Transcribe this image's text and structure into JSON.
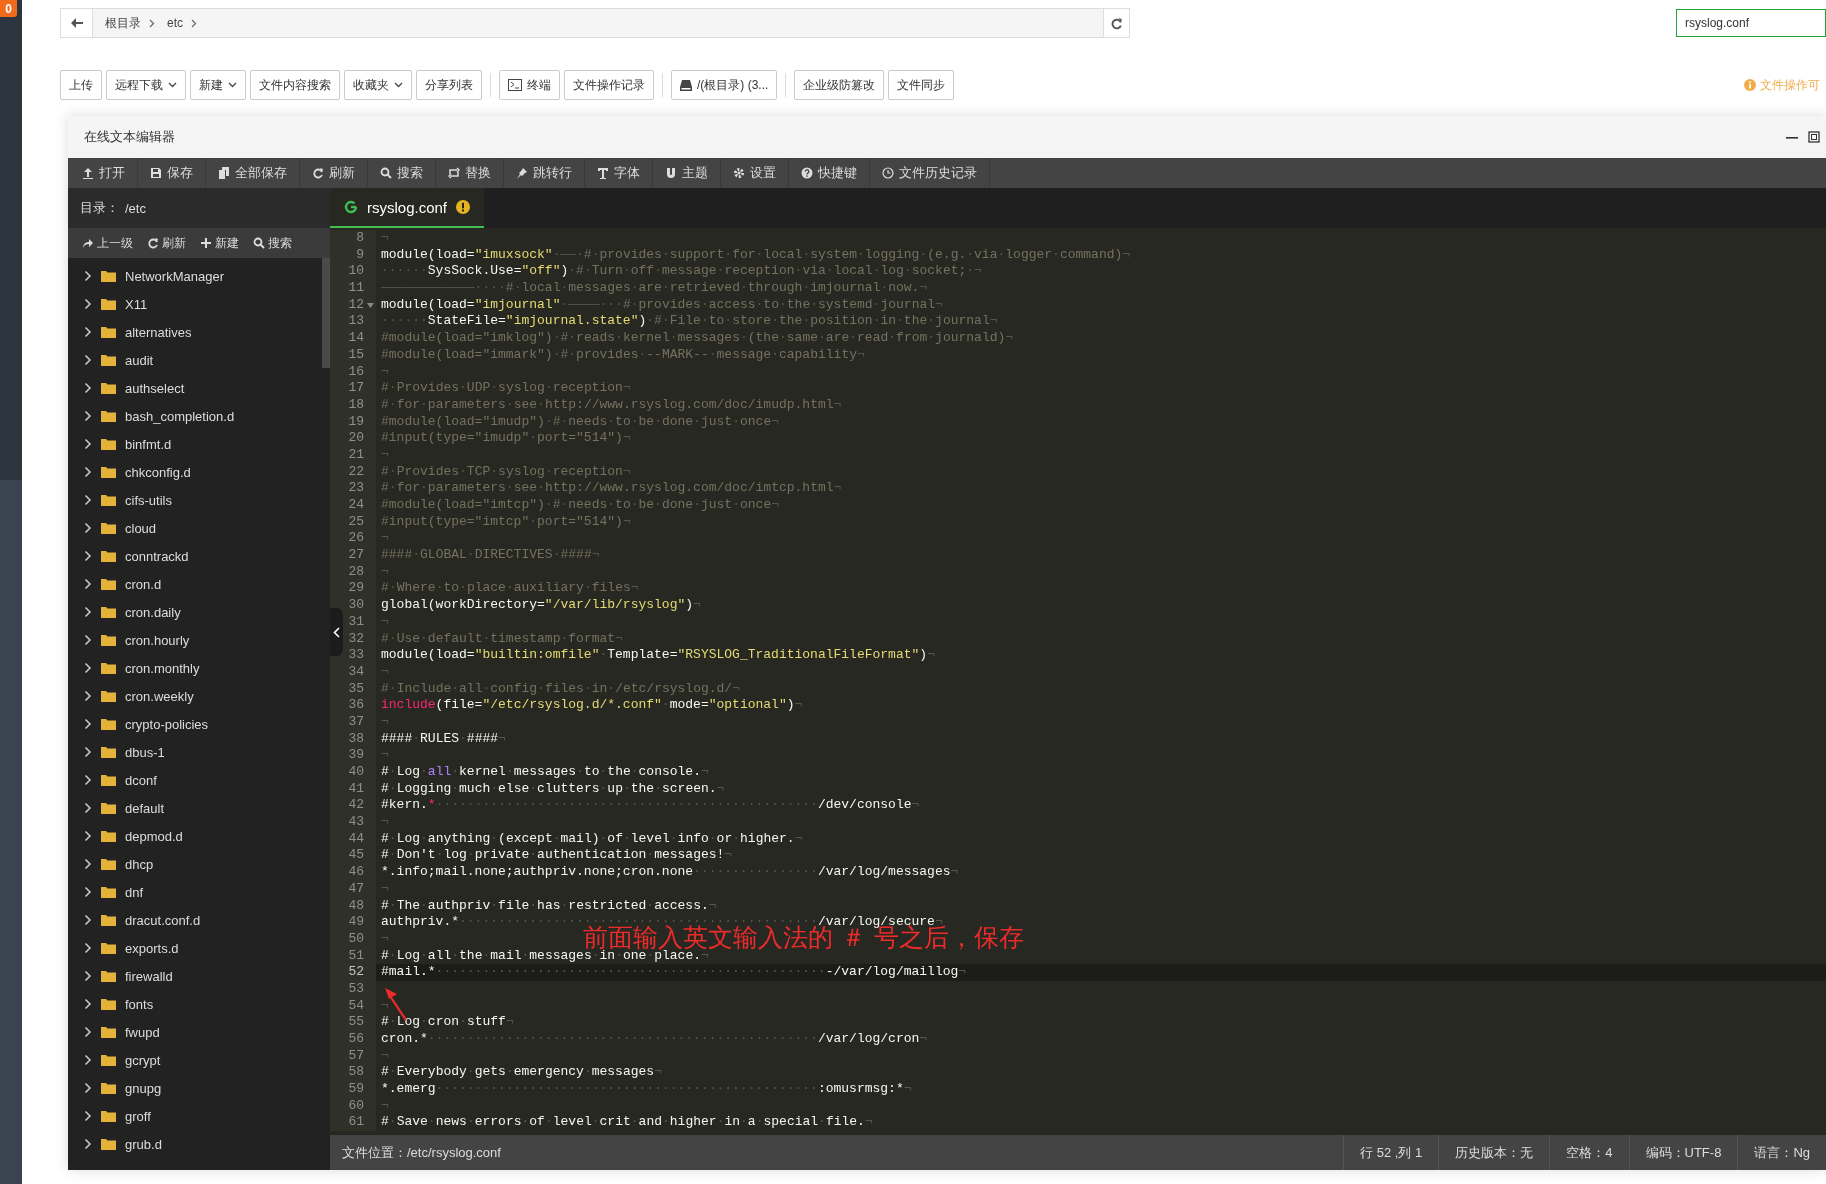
{
  "notification_count": "0",
  "breadcrumb": [
    "根目录",
    "etc"
  ],
  "path_search": {
    "value": "rsyslog.conf"
  },
  "toolbar": [
    {
      "label": "上传",
      "kind": "plain"
    },
    {
      "label": "远程下载",
      "kind": "dropdown"
    },
    {
      "label": "新建",
      "kind": "dropdown"
    },
    {
      "label": "文件内容搜索",
      "kind": "plain"
    },
    {
      "label": "收藏夹",
      "kind": "dropdown"
    },
    {
      "label": "分享列表",
      "kind": "plain"
    },
    {
      "label": "终端",
      "kind": "terminal"
    },
    {
      "label": "文件操作记录",
      "kind": "plain"
    },
    {
      "label": "/(根目录) (3...",
      "kind": "disk"
    },
    {
      "label": "企业级防篡改",
      "kind": "plain"
    },
    {
      "label": "文件同步",
      "kind": "plain"
    }
  ],
  "notice": "文件操作可",
  "editor": {
    "title": "在线文本编辑器",
    "toolbar": [
      "打开",
      "保存",
      "全部保存",
      "刷新",
      "搜索",
      "替换",
      "跳转行",
      "字体",
      "主题",
      "设置",
      "快捷键",
      "文件历史记录"
    ],
    "sidebar": {
      "dir_label": "目录：",
      "dir": "/etc",
      "actions": [
        "上一级",
        "刷新",
        "新建",
        "搜索"
      ],
      "items": [
        {
          "name": "NetworkManager",
          "expanded": false
        },
        {
          "name": "X11",
          "expanded": false
        },
        {
          "name": "alternatives",
          "expanded": false
        },
        {
          "name": "audit",
          "expanded": false
        },
        {
          "name": "authselect",
          "expanded": false
        },
        {
          "name": "bash_completion.d",
          "expanded": false
        },
        {
          "name": "binfmt.d",
          "expanded": false
        },
        {
          "name": "chkconfig.d",
          "expanded": false
        },
        {
          "name": "cifs-utils",
          "expanded": false
        },
        {
          "name": "cloud",
          "expanded": false
        },
        {
          "name": "conntrackd",
          "expanded": false
        },
        {
          "name": "cron.d",
          "expanded": false
        },
        {
          "name": "cron.daily",
          "expanded": false
        },
        {
          "name": "cron.hourly",
          "expanded": false
        },
        {
          "name": "cron.monthly",
          "expanded": false
        },
        {
          "name": "cron.weekly",
          "expanded": false
        },
        {
          "name": "crypto-policies",
          "expanded": false
        },
        {
          "name": "dbus-1",
          "expanded": false
        },
        {
          "name": "dconf",
          "expanded": false
        },
        {
          "name": "default",
          "expanded": false
        },
        {
          "name": "depmod.d",
          "expanded": false
        },
        {
          "name": "dhcp",
          "expanded": false
        },
        {
          "name": "dnf",
          "expanded": false
        },
        {
          "name": "dracut.conf.d",
          "expanded": false
        },
        {
          "name": "exports.d",
          "expanded": false
        },
        {
          "name": "firewalld",
          "expanded": false
        },
        {
          "name": "fonts",
          "expanded": false
        },
        {
          "name": "fwupd",
          "expanded": false
        },
        {
          "name": "gcrypt",
          "expanded": false
        },
        {
          "name": "gnupg",
          "expanded": false
        },
        {
          "name": "groff",
          "expanded": false
        },
        {
          "name": "grub.d",
          "expanded": false
        }
      ]
    },
    "tabs": [
      {
        "label": "rsyslog.conf",
        "selected": true,
        "modified": true
      }
    ],
    "lines": [
      {
        "n": "8",
        "active": false,
        "segs": [
          {
            "text": "¬",
            "kind": "p"
          }
        ]
      },
      {
        "n": "9",
        "active": false,
        "segs": [
          {
            "text": "module(load=",
            "kind": "p"
          },
          {
            "text": "\"imuxsock\"",
            "kind": "s"
          },
          {
            "text": "·——·",
            "kind": "p"
          },
          {
            "text": "#·provides·support·for·local·system·logging·(e.g.·via·logger·command)¬",
            "kind": "c"
          }
        ]
      },
      {
        "n": "10",
        "active": false,
        "segs": [
          {
            "text": "······SysSock.Use=",
            "kind": "p"
          },
          {
            "text": "\"off\"",
            "kind": "s"
          },
          {
            "text": ")·",
            "kind": "p"
          },
          {
            "text": "#·Turn·off·message·reception·via·local·log·socket;·¬",
            "kind": "c"
          }
        ]
      },
      {
        "n": "11",
        "active": false,
        "segs": [
          {
            "text": "————————————····",
            "kind": "p"
          },
          {
            "text": "#·local·messages·are·retrieved·through·imjournal·now.¬",
            "kind": "c"
          }
        ]
      },
      {
        "n": "12",
        "active": false,
        "fold": true,
        "segs": [
          {
            "text": "module(load=",
            "kind": "p"
          },
          {
            "text": "\"imjournal\"",
            "kind": "s"
          },
          {
            "text": "·————···",
            "kind": "p"
          },
          {
            "text": "#·provides·access·to·the·systemd·journal¬",
            "kind": "c"
          }
        ]
      },
      {
        "n": "13",
        "active": false,
        "segs": [
          {
            "text": "······StateFile=",
            "kind": "p"
          },
          {
            "text": "\"imjournal.state\"",
            "kind": "s"
          },
          {
            "text": ")·",
            "kind": "p"
          },
          {
            "text": "#·File·to·store·the·position·in·the·journal¬",
            "kind": "c"
          }
        ]
      },
      {
        "n": "14",
        "active": false,
        "segs": [
          {
            "text": "#module(load=\"imklog\")·#·reads·kernel·messages·(the·same·are·read·from·journald)¬",
            "kind": "c"
          }
        ]
      },
      {
        "n": "15",
        "active": false,
        "segs": [
          {
            "text": "#module(load=\"immark\")·#·provides·--MARK--·message·capability¬",
            "kind": "c"
          }
        ]
      },
      {
        "n": "16",
        "active": false,
        "segs": [
          {
            "text": "¬",
            "kind": "p"
          }
        ]
      },
      {
        "n": "17",
        "active": false,
        "segs": [
          {
            "text": "#·Provides·UDP·syslog·reception¬",
            "kind": "c"
          }
        ]
      },
      {
        "n": "18",
        "active": false,
        "segs": [
          {
            "text": "#·for·parameters·see·http://www.rsyslog.com/doc/imudp.html¬",
            "kind": "c"
          }
        ]
      },
      {
        "n": "19",
        "active": false,
        "segs": [
          {
            "text": "#module(load=\"imudp\")·#·needs·to·be·done·just·once¬",
            "kind": "c"
          }
        ]
      },
      {
        "n": "20",
        "active": false,
        "segs": [
          {
            "text": "#input(type=\"imudp\"·port=\"514\")¬",
            "kind": "c"
          }
        ]
      },
      {
        "n": "21",
        "active": false,
        "segs": [
          {
            "text": "¬",
            "kind": "p"
          }
        ]
      },
      {
        "n": "22",
        "active": false,
        "segs": [
          {
            "text": "#·Provides·TCP·syslog·reception¬",
            "kind": "c"
          }
        ]
      },
      {
        "n": "23",
        "active": false,
        "segs": [
          {
            "text": "#·for·parameters·see·http://www.rsyslog.com/doc/imtcp.html¬",
            "kind": "c"
          }
        ]
      },
      {
        "n": "24",
        "active": false,
        "segs": [
          {
            "text": "#module(load=\"imtcp\")·#·needs·to·be·done·just·once¬",
            "kind": "c"
          }
        ]
      },
      {
        "n": "25",
        "active": false,
        "segs": [
          {
            "text": "#input(type=\"imtcp\"·port=\"514\")¬",
            "kind": "c"
          }
        ]
      },
      {
        "n": "26",
        "active": false,
        "segs": [
          {
            "text": "¬",
            "kind": "p"
          }
        ]
      },
      {
        "n": "27",
        "active": false,
        "segs": [
          {
            "text": "####·GLOBAL·DIRECTIVES·####¬",
            "kind": "c"
          }
        ]
      },
      {
        "n": "28",
        "active": false,
        "segs": [
          {
            "text": "¬",
            "kind": "p"
          }
        ]
      },
      {
        "n": "29",
        "active": false,
        "segs": [
          {
            "text": "#·Where·to·place·auxiliary·files¬",
            "kind": "c"
          }
        ]
      },
      {
        "n": "30",
        "active": false,
        "segs": [
          {
            "text": "global(workDirectory=",
            "kind": "p"
          },
          {
            "text": "\"/var/lib/rsyslog\"",
            "kind": "s"
          },
          {
            "text": ")¬",
            "kind": "p"
          }
        ]
      },
      {
        "n": "31",
        "active": false,
        "segs": [
          {
            "text": "¬",
            "kind": "p"
          }
        ]
      },
      {
        "n": "32",
        "active": false,
        "segs": [
          {
            "text": "#·Use·default·timestamp·format¬",
            "kind": "c"
          }
        ]
      },
      {
        "n": "33",
        "active": false,
        "segs": [
          {
            "text": "module(load=",
            "kind": "p"
          },
          {
            "text": "\"builtin:omfile\"",
            "kind": "s"
          },
          {
            "text": "·Template=",
            "kind": "p"
          },
          {
            "text": "\"RSYSLOG_TraditionalFileFormat\"",
            "kind": "s"
          },
          {
            "text": ")¬",
            "kind": "p"
          }
        ]
      },
      {
        "n": "34",
        "active": false,
        "segs": [
          {
            "text": "¬",
            "kind": "p"
          }
        ]
      },
      {
        "n": "35",
        "active": false,
        "segs": [
          {
            "text": "#·Include·all·config·files·in·/etc/rsyslog.d/¬",
            "kind": "c"
          }
        ]
      },
      {
        "n": "36",
        "active": false,
        "segs": [
          {
            "text": "include",
            "kind": "k"
          },
          {
            "text": "(file=",
            "kind": "p"
          },
          {
            "text": "\"/etc/rsyslog.d/*.conf\"",
            "kind": "s"
          },
          {
            "text": "·mode=",
            "kind": "p"
          },
          {
            "text": "\"optional\"",
            "kind": "s"
          },
          {
            "text": ")¬",
            "kind": "p"
          }
        ]
      },
      {
        "n": "37",
        "active": false,
        "segs": [
          {
            "text": "¬",
            "kind": "p"
          }
        ]
      },
      {
        "n": "38",
        "active": false,
        "segs": [
          {
            "text": "####·RULES·####¬",
            "kind": "p"
          }
        ]
      },
      {
        "n": "39",
        "active": false,
        "segs": [
          {
            "text": "¬",
            "kind": "p"
          }
        ]
      },
      {
        "n": "40",
        "active": false,
        "segs": [
          {
            "text": "#·Log·",
            "kind": "p"
          },
          {
            "text": "all",
            "kind": "v"
          },
          {
            "text": "·kernel·messages·to·the·console.¬",
            "kind": "p"
          }
        ]
      },
      {
        "n": "41",
        "active": false,
        "segs": [
          {
            "text": "#·Logging·much·else·clutters·up·the·screen.¬",
            "kind": "p"
          }
        ]
      },
      {
        "n": "42",
        "active": false,
        "segs": [
          {
            "text": "#kern.",
            "kind": "p"
          },
          {
            "text": "*",
            "kind": "k"
          },
          {
            "text": "·················································/dev/console¬",
            "kind": "p"
          }
        ]
      },
      {
        "n": "43",
        "active": false,
        "segs": [
          {
            "text": "¬",
            "kind": "p"
          }
        ]
      },
      {
        "n": "44",
        "active": false,
        "segs": [
          {
            "text": "#·Log·anything·(except·mail)·of·level·info·or·higher.¬",
            "kind": "p"
          }
        ]
      },
      {
        "n": "45",
        "active": false,
        "segs": [
          {
            "text": "#·Don't·log·private·authentication·messages!¬",
            "kind": "p"
          }
        ]
      },
      {
        "n": "46",
        "active": false,
        "segs": [
          {
            "text": "*.info;mail.none;authpriv.none;cron.none················/var/log/messages¬",
            "kind": "p"
          }
        ]
      },
      {
        "n": "47",
        "active": false,
        "segs": [
          {
            "text": "¬",
            "kind": "p"
          }
        ]
      },
      {
        "n": "48",
        "active": false,
        "segs": [
          {
            "text": "#·The·authpriv·file·has·restricted·access.¬",
            "kind": "p"
          }
        ]
      },
      {
        "n": "49",
        "active": false,
        "segs": [
          {
            "text": "authpriv.*··············································/var/log/secure¬",
            "kind": "p"
          }
        ]
      },
      {
        "n": "50",
        "active": false,
        "segs": [
          {
            "text": "¬",
            "kind": "p"
          }
        ]
      },
      {
        "n": "51",
        "active": false,
        "segs": [
          {
            "text": "#·Log·all·the·mail·messages·in·one·place.¬",
            "kind": "p"
          }
        ]
      },
      {
        "n": "52",
        "active": true,
        "segs": [
          {
            "text": "#mail.*··················································-/var/log/maillog¬",
            "kind": "p"
          }
        ]
      },
      {
        "n": "53",
        "active": false
      },
      {
        "n": "54",
        "active": false,
        "segs": [
          {
            "text": "¬",
            "kind": "p"
          }
        ]
      },
      {
        "n": "55",
        "active": false,
        "segs": [
          {
            "text": "#·Log·cron·stuff¬",
            "kind": "p"
          }
        ]
      },
      {
        "n": "56",
        "active": false,
        "segs": [
          {
            "text": "cron.*··················································/var/log/cron¬",
            "kind": "p"
          }
        ]
      },
      {
        "n": "57",
        "active": false,
        "segs": [
          {
            "text": "¬",
            "kind": "p"
          }
        ]
      },
      {
        "n": "58",
        "active": false,
        "segs": [
          {
            "text": "#·Everybody·gets·emergency·messages¬",
            "kind": "p"
          }
        ]
      },
      {
        "n": "59",
        "active": false,
        "segs": [
          {
            "text": "*.emerg·················································:omusrmsg:*¬",
            "kind": "p"
          }
        ]
      },
      {
        "n": "60",
        "active": false,
        "segs": [
          {
            "text": "¬",
            "kind": "p"
          }
        ]
      },
      {
        "n": "61",
        "active": false,
        "segs": [
          {
            "text": "#·Save·news·errors·of·level·crit·and·higher·in·a·special·file.¬",
            "kind": "p"
          }
        ]
      }
    ],
    "annotation": "前面输入英文输入法的 ＃ 号之后，保存",
    "status_bar": {
      "file": "文件位置：/etc/rsyslog.conf",
      "items": [
        "行 52 ,列 1",
        "历史版本：无",
        "空格：4",
        "编码：UTF-8",
        "语言：Ng"
      ]
    }
  }
}
